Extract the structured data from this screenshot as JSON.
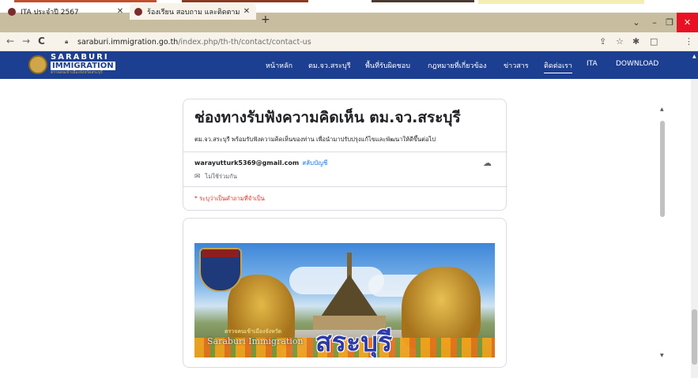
{
  "browser": {
    "tabs": [
      {
        "title": "ITA ประจำปี 2567",
        "active": false
      },
      {
        "title": "ร้องเรียน สอบถาม และติดตาม",
        "active": true
      }
    ],
    "new_tab": "+",
    "url_host": "saraburi.immigration.go.th",
    "url_path": "/index.php/th-th/contact/contact-us",
    "window": {
      "dropdown": "⌄",
      "minimize": "–",
      "maximize": "❐",
      "close": "✕"
    },
    "nav": {
      "back": "←",
      "forward": "→",
      "reload": "C"
    },
    "toolbar": {
      "share": "⇪",
      "star": "☆",
      "extensions": "✱",
      "sidebar": "□",
      "menu": "⋮"
    }
  },
  "site": {
    "brand": {
      "line1": "SARABURI",
      "line2": "IMMIGRATION",
      "line3": "ตรวจคนเข้าเมืองจังหวัดสระบุรี"
    },
    "menu": [
      {
        "label": "หน้าหลัก",
        "active": false
      },
      {
        "label": "ตม.จว.สระบุรี",
        "active": false
      },
      {
        "label": "พื้นที่รับผิดชอบ",
        "active": false
      },
      {
        "label": "กฎหมายที่เกี่ยวข้อง",
        "active": false
      },
      {
        "label": "ข่าวสาร",
        "active": false
      },
      {
        "label": "ติดต่อเรา",
        "active": true
      },
      {
        "label": "ITA",
        "active": false
      },
      {
        "label": "DOWNLOAD",
        "active": false
      }
    ]
  },
  "form": {
    "title": "ช่องทางรับฟังความคิดเห็น ตม.จว.สระบุรี",
    "description": "ตม.จว.สระบุรี พร้อมรับฟังความคิดเห็นของท่าน เพื่อนำมาปรับปรุงแก้ไขและพัฒนาให้ดีขึ้นต่อไป",
    "account_email": "warayutturk5369@gmail.com",
    "switch_account": "สลับบัญชี",
    "not_shared": "ไม่ใช้ร่วมกัน",
    "required_note": "* ระบุว่าเป็นคำถามที่จำเป็น"
  },
  "banner": {
    "subtext": "ตรวจคนเข้าเมืองจังหวัด",
    "caption_en": "Saraburi Immigration",
    "caption_th": "สระบุรี"
  },
  "colors": {
    "site_nav": "#1d3f91",
    "tabbar": "#c9bda0",
    "required": "#d93025",
    "link": "#1a73e8"
  },
  "icons": {
    "favicon": "police-emblem-icon",
    "cloud": "cloud-off-icon",
    "not_shared": "mail-icon",
    "lock": "lock-icon"
  }
}
